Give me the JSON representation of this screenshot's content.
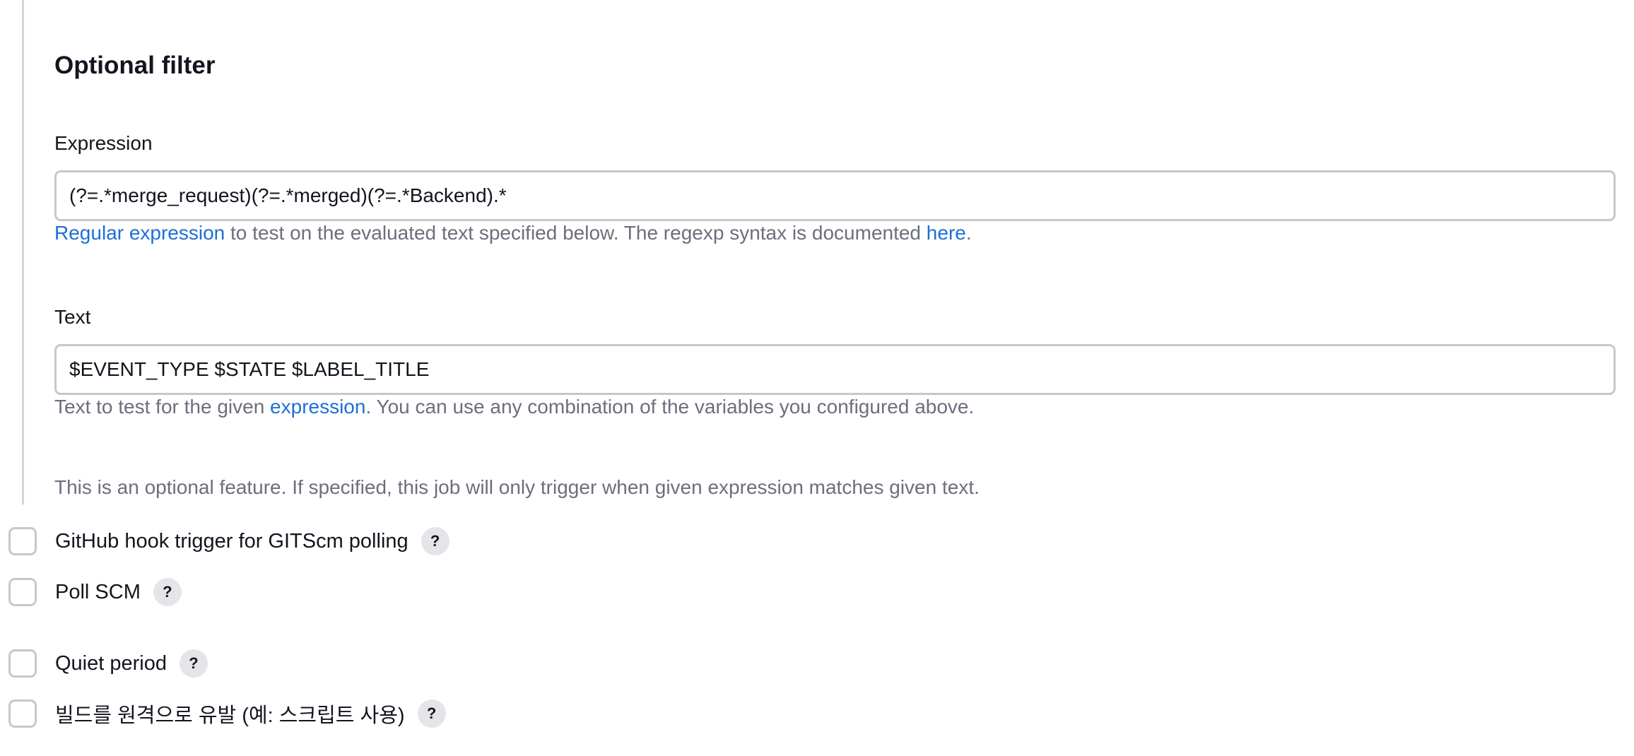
{
  "filter": {
    "title": "Optional filter",
    "expression": {
      "label": "Expression",
      "value": "(?=.*merge_request)(?=.*merged)(?=.*Backend).*",
      "help_link": "Regular expression",
      "help_middle": " to test on the evaluated text specified below. The regexp syntax is documented ",
      "help_link2": "here",
      "help_end": "."
    },
    "text": {
      "label": "Text",
      "value": "$EVENT_TYPE $STATE $LABEL_TITLE",
      "help_start": "Text to test for the given ",
      "help_link": "expression",
      "help_end": ". You can use any combination of the variables you configured above."
    },
    "note": "This is an optional feature. If specified, this job will only trigger when given expression matches given text."
  },
  "triggers": [
    {
      "label": "GitHub hook trigger for GITScm polling",
      "help": "?",
      "checked": false
    },
    {
      "label": "Poll SCM",
      "help": "?",
      "checked": false
    },
    {
      "label": "Quiet period",
      "help": "?",
      "checked": false
    },
    {
      "label": "빌드를 원격으로 유발 (예: 스크립트 사용)",
      "help": "?",
      "checked": false
    }
  ],
  "colors": {
    "link": "#1f6fd6",
    "help_text": "#6d6e7d",
    "border": "#c4c8cc"
  }
}
